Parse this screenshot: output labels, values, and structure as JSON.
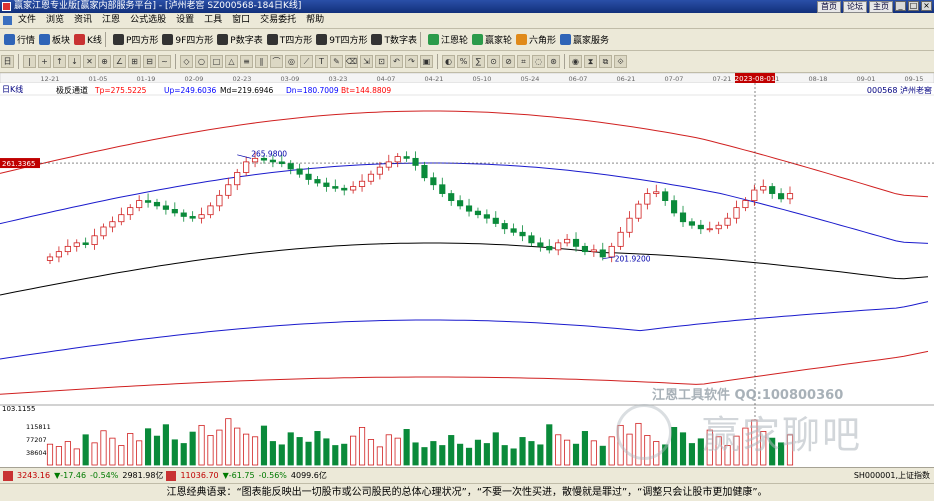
{
  "window": {
    "title": "赢家江恩专业版[赢家内部服务平台] - [泸州老窖  SZ000568-184日K线]",
    "links": [
      "首页",
      "论坛",
      "主页"
    ],
    "controls": [
      "_",
      "□",
      "×"
    ]
  },
  "menu": [
    "文件",
    "浏览",
    "资讯",
    "江恩",
    "公式选股",
    "设置",
    "工具",
    "窗口",
    "交易委托",
    "帮助"
  ],
  "toolbar1": [
    {
      "label": "行情",
      "icon": "quote-icon",
      "color": "blue"
    },
    {
      "label": "板块",
      "icon": "sector-icon",
      "color": "blue"
    },
    {
      "label": "K线",
      "icon": "kline-icon",
      "color": "red"
    },
    {
      "label": "P四方形",
      "icon": "p-square-icon",
      "color": "dark"
    },
    {
      "label": "9F四方形",
      "icon": "9f-square-icon",
      "color": "dark"
    },
    {
      "label": "P数字表",
      "icon": "p-number-table-icon",
      "color": "dark"
    },
    {
      "label": "T四方形",
      "icon": "t-square-icon",
      "color": "dark"
    },
    {
      "label": "9T四方形",
      "icon": "9t-square-icon",
      "color": "dark"
    },
    {
      "label": "T数字表",
      "icon": "t-number-table-icon",
      "color": "dark"
    },
    {
      "label": "江恩轮",
      "icon": "gann-wheel-icon",
      "color": "green"
    },
    {
      "label": "赢家轮",
      "icon": "winner-wheel-icon",
      "color": "green"
    },
    {
      "label": "六角形",
      "icon": "hexagon-icon",
      "color": "orange"
    },
    {
      "label": "赢家服务",
      "icon": "service-icon",
      "color": "blue"
    }
  ],
  "toolbar2": [
    "日",
    "|",
    "+",
    "↑",
    "↓",
    "✕",
    "⊕",
    "∠",
    "⊞",
    "⊟",
    "~",
    "◇",
    "○",
    "□",
    "△",
    "≡",
    "∥",
    "⌒",
    "◎",
    "⟋",
    "T",
    "✎",
    "⌫",
    "⇲",
    "⊡",
    "↶",
    "↷",
    "▣",
    "◐",
    "%",
    "∑",
    "⊙",
    "⊘",
    "⌗",
    "◌",
    "⊛",
    "◉",
    "⧗",
    "⧉",
    "⟐"
  ],
  "chart_data": {
    "type": "candlestick",
    "period_label": "日K线",
    "indicator_label": "极反通道",
    "indicators": [
      {
        "name": "Tp",
        "value": "275.5225",
        "color": "#ff0000"
      },
      {
        "name": "Up",
        "value": "249.6036",
        "color": "#0000ff"
      },
      {
        "name": "Md",
        "value": "219.6946",
        "color": "#000000"
      },
      {
        "name": "Dn",
        "value": "180.7009",
        "color": "#0000ff"
      },
      {
        "name": "Bt",
        "value": "144.8809",
        "color": "#ff0000"
      }
    ],
    "stock_label": "000568 泸州老窖",
    "date_ticks": [
      "12-21",
      "01-05",
      "01-19",
      "02-09",
      "02-23",
      "03-09",
      "03-23",
      "04-07",
      "04-21",
      "05-10",
      "05-24",
      "06-07",
      "06-21",
      "07-07",
      "07-21",
      "08-01",
      "08-18",
      "09-01",
      "09-15"
    ],
    "date_highlight": "2023-08-01",
    "price_axis_label": "261.3365",
    "high_annotation": "265.9800",
    "low_annotation": "201.9200",
    "ylim": [
      125,
      300
    ],
    "closes": [
      208,
      211,
      214,
      216,
      215,
      220,
      225,
      228,
      232,
      236,
      240,
      239,
      237,
      235,
      233,
      231,
      230,
      232,
      237,
      243,
      249,
      256,
      262,
      264,
      263,
      262,
      261,
      258,
      255,
      252,
      250,
      248,
      247,
      246,
      248,
      251,
      255,
      259,
      262,
      265,
      264,
      260,
      253,
      249,
      244,
      240,
      237,
      234,
      232,
      230,
      227,
      224,
      222,
      220,
      216,
      214,
      212,
      216,
      218,
      214,
      211,
      212,
      208,
      214,
      222,
      230,
      238,
      244,
      245,
      240,
      233,
      228,
      226,
      224,
      224,
      226,
      230,
      236,
      240,
      246,
      248,
      244,
      241,
      244
    ],
    "volume_ticks": [
      "115811",
      "77207",
      "38604"
    ],
    "volume_axis_label": "103.1155",
    "volume_ylim": [
      0,
      140000
    ],
    "volumes": [
      62000,
      55000,
      70000,
      48000,
      90000,
      66000,
      102000,
      80000,
      58000,
      94000,
      72000,
      108000,
      86000,
      120000,
      75000,
      64000,
      98000,
      118000,
      88000,
      104000,
      138000,
      110000,
      92000,
      84000,
      116000,
      70000,
      60000,
      96000,
      82000,
      68000,
      100000,
      78000,
      58000,
      62000,
      86000,
      112000,
      76000,
      54000,
      90000,
      80000,
      106000,
      66000,
      52000,
      70000,
      58000,
      88000,
      62000,
      50000,
      74000,
      64000,
      96000,
      58000,
      48000,
      82000,
      70000,
      60000,
      120000,
      90000,
      74000,
      62000,
      100000,
      72000,
      56000,
      84000,
      118000,
      92000,
      124000,
      88000,
      70000,
      60000,
      112000,
      96000,
      64000,
      78000,
      104000,
      84000,
      58000,
      86000,
      110000,
      134000,
      100000,
      80000,
      66000,
      90000
    ]
  },
  "statusbar": {
    "sh_index": "3243.16",
    "sh_change": "▼-17.46",
    "sh_pct": "-0.54%",
    "sh_amount": "2981.98亿",
    "sz_index": "11036.70",
    "sz_change": "▼-61.75",
    "sz_pct": "-0.56%",
    "sz_amount": "4099.6亿",
    "right_text": "SH000001,上证指数"
  },
  "watermark": {
    "line1": "江恩工具软件  QQ:100800360",
    "line2": "赢家聊吧"
  },
  "footer": "江恩经典语录：“图表能反映出一切股市或公司股民的总体心理状况”，“不要一次性买进，散慢就是罪过”，“调整只会让股市更加健康”。"
}
